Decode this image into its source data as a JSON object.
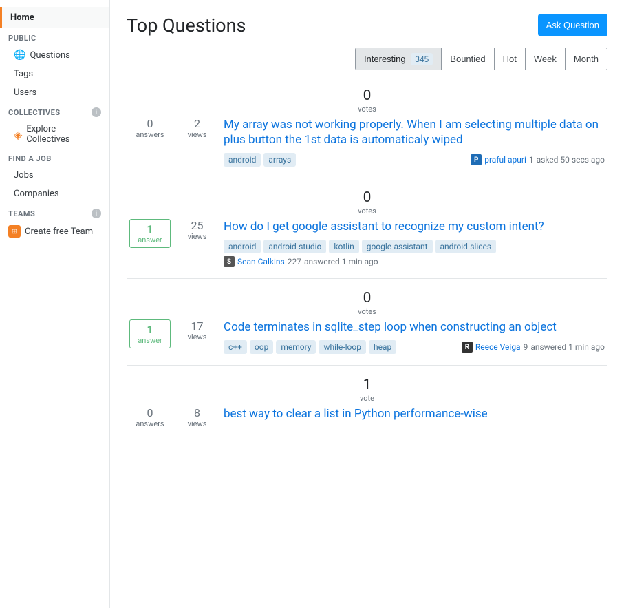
{
  "sidebar": {
    "home_label": "Home",
    "public_label": "PUBLIC",
    "questions_label": "Questions",
    "tags_label": "Tags",
    "users_label": "Users",
    "collectives_label": "COLLECTIVES",
    "explore_collectives_label": "Explore Collectives",
    "find_job_label": "FIND A JOB",
    "jobs_label": "Jobs",
    "companies_label": "Companies",
    "teams_label": "TEAMS",
    "create_team_label": "Create free Team"
  },
  "header": {
    "title": "Top Questions",
    "ask_button": "Ask Question"
  },
  "filters": {
    "interesting": "Interesting",
    "badge_count": "345",
    "bountied": "Bountied",
    "hot": "Hot",
    "week": "Week",
    "month": "Month"
  },
  "questions": [
    {
      "id": 1,
      "votes": 0,
      "votes_label": "votes",
      "answers": 0,
      "answers_label": "answers",
      "views": 2,
      "views_label": "views",
      "has_answer": false,
      "title": "My array was not working properly. When I am selecting multiple data on plus button the 1st data is automaticaly wiped",
      "tags": [
        "android",
        "arrays"
      ],
      "user_avatar_color": "#1e6cb5",
      "user_avatar_letter": "P",
      "user_name": "praful apuri",
      "user_rep": "1",
      "action": "asked",
      "time": "50 secs ago"
    },
    {
      "id": 2,
      "votes": 0,
      "votes_label": "votes",
      "answers": 1,
      "answers_label": "answer",
      "views": 25,
      "views_label": "views",
      "has_answer": true,
      "title": "How do I get google assistant to recognize my custom intent?",
      "tags": [
        "android",
        "android-studio",
        "kotlin",
        "google-assistant",
        "android-slices"
      ],
      "user_avatar_color": "#555",
      "user_avatar_letter": "S",
      "user_name": "Sean Calkins",
      "user_rep": "227",
      "action": "answered",
      "time": "1 min ago"
    },
    {
      "id": 3,
      "votes": 0,
      "votes_label": "votes",
      "answers": 1,
      "answers_label": "answer",
      "views": 17,
      "views_label": "views",
      "has_answer": true,
      "title": "Code terminates in sqlite_step loop when constructing an object",
      "tags": [
        "c++",
        "oop",
        "memory",
        "while-loop",
        "heap"
      ],
      "user_avatar_color": "#333",
      "user_avatar_letter": "R",
      "user_name": "Reece Veiga",
      "user_rep": "9",
      "action": "answered",
      "time": "1 min ago"
    },
    {
      "id": 4,
      "votes": 1,
      "votes_label": "vote",
      "answers": 0,
      "answers_label": "answers",
      "views": 8,
      "views_label": "views",
      "has_answer": false,
      "title": "best way to clear a list in Python performance-wise",
      "tags": [],
      "user_avatar_color": "#888",
      "user_avatar_letter": "?",
      "user_name": "",
      "user_rep": "",
      "action": "",
      "time": ""
    }
  ]
}
